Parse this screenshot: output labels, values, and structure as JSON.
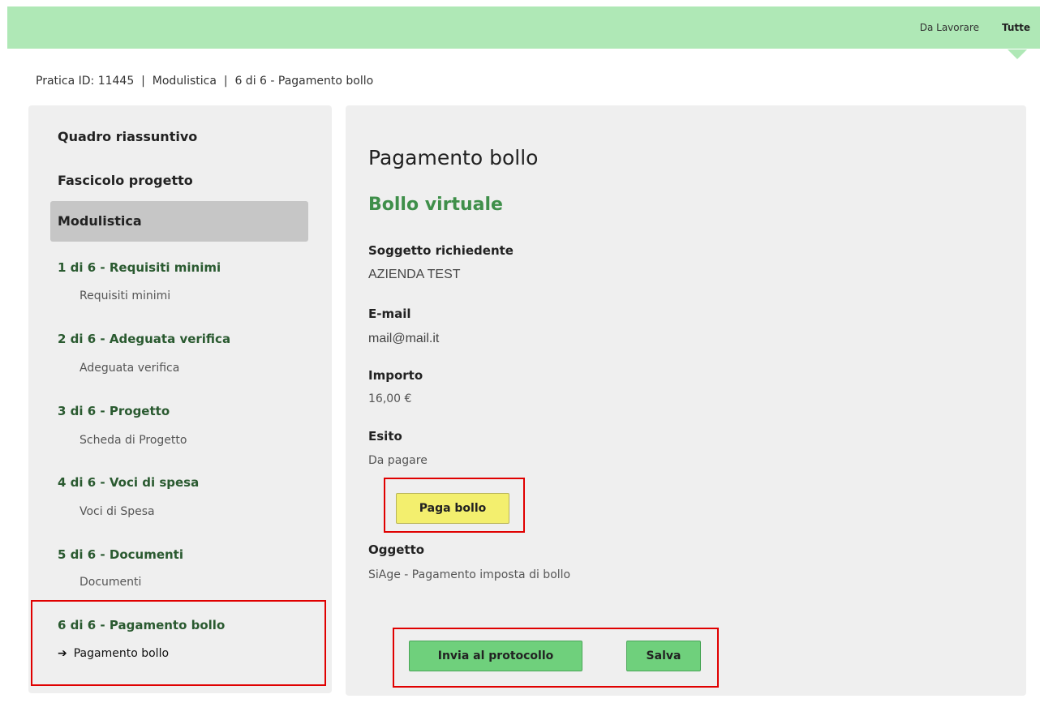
{
  "topnav": {
    "da_lavorare": "Da Lavorare",
    "tutte": "Tutte"
  },
  "breadcrumb": {
    "pratica": "Pratica ID: 11445",
    "sep1": "  |  ",
    "modulistica": "Modulistica",
    "sep2": "  |  ",
    "step": "6 di 6 - Pagamento bollo"
  },
  "sidebar": {
    "quadro": "Quadro riassuntivo",
    "fascicolo": "Fascicolo progetto",
    "modulistica": "Modulistica",
    "steps": [
      {
        "title": "1 di 6 - Requisiti minimi",
        "sub": "Requisiti minimi"
      },
      {
        "title": "2 di 6 - Adeguata verifica",
        "sub": "Adeguata verifica"
      },
      {
        "title": "3 di 6 - Progetto",
        "sub": "Scheda di Progetto"
      },
      {
        "title": "4 di 6 - Voci di spesa",
        "sub": "Voci di Spesa"
      },
      {
        "title": "5 di 6 - Documenti",
        "sub": "Documenti"
      },
      {
        "title": "6 di 6 - Pagamento bollo",
        "sub": "Pagamento bollo"
      }
    ],
    "arrow": "➔"
  },
  "main": {
    "title": "Pagamento bollo",
    "subtitle": "Bollo virtuale",
    "soggetto_label": "Soggetto richiedente",
    "soggetto_value": "AZIENDA TEST",
    "email_label": "E-mail",
    "email_value": "mail@mail.it",
    "importo_label": "Importo",
    "importo_value": "16,00 €",
    "esito_label": "Esito",
    "esito_value": "Da pagare",
    "paga_button": "Paga bollo",
    "oggetto_label": "Oggetto",
    "oggetto_value": "SiAge - Pagamento imposta di bollo",
    "invia_button": "Invia al protocollo",
    "salva_button": "Salva"
  },
  "colors": {
    "topbar": "#afe8b6",
    "accent_green": "#3f8f4a",
    "button_green": "#6fd07c",
    "button_yellow": "#f3ef6e",
    "highlight_red": "#e00000"
  }
}
